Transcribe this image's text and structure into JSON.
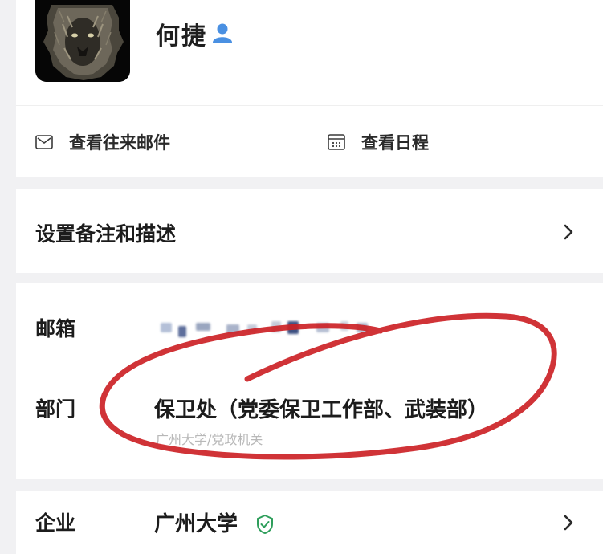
{
  "profile": {
    "name": "何捷",
    "avatar_icon": "lion-portrait-icon",
    "person_badge_icon": "person-icon",
    "badge_color": "#4a90e2"
  },
  "actions": {
    "mail_label": "查看往来邮件",
    "mail_icon": "envelope-icon",
    "calendar_label": "查看日程",
    "calendar_icon": "calendar-icon"
  },
  "remark": {
    "label": "设置备注和描述",
    "chevron_icon": "chevron-right-icon"
  },
  "info": {
    "email_label": "邮箱",
    "department_label": "部门",
    "department_value": "保卫处（党委保卫工作部、武装部）",
    "department_path": "广州大学/党政机关"
  },
  "company": {
    "label": "企业",
    "value": "广州大学",
    "verified_icon": "shield-check-icon",
    "verified_color": "#2e9e5b",
    "chevron_icon": "chevron-right-icon"
  },
  "annotation": {
    "color": "#cc2226"
  }
}
